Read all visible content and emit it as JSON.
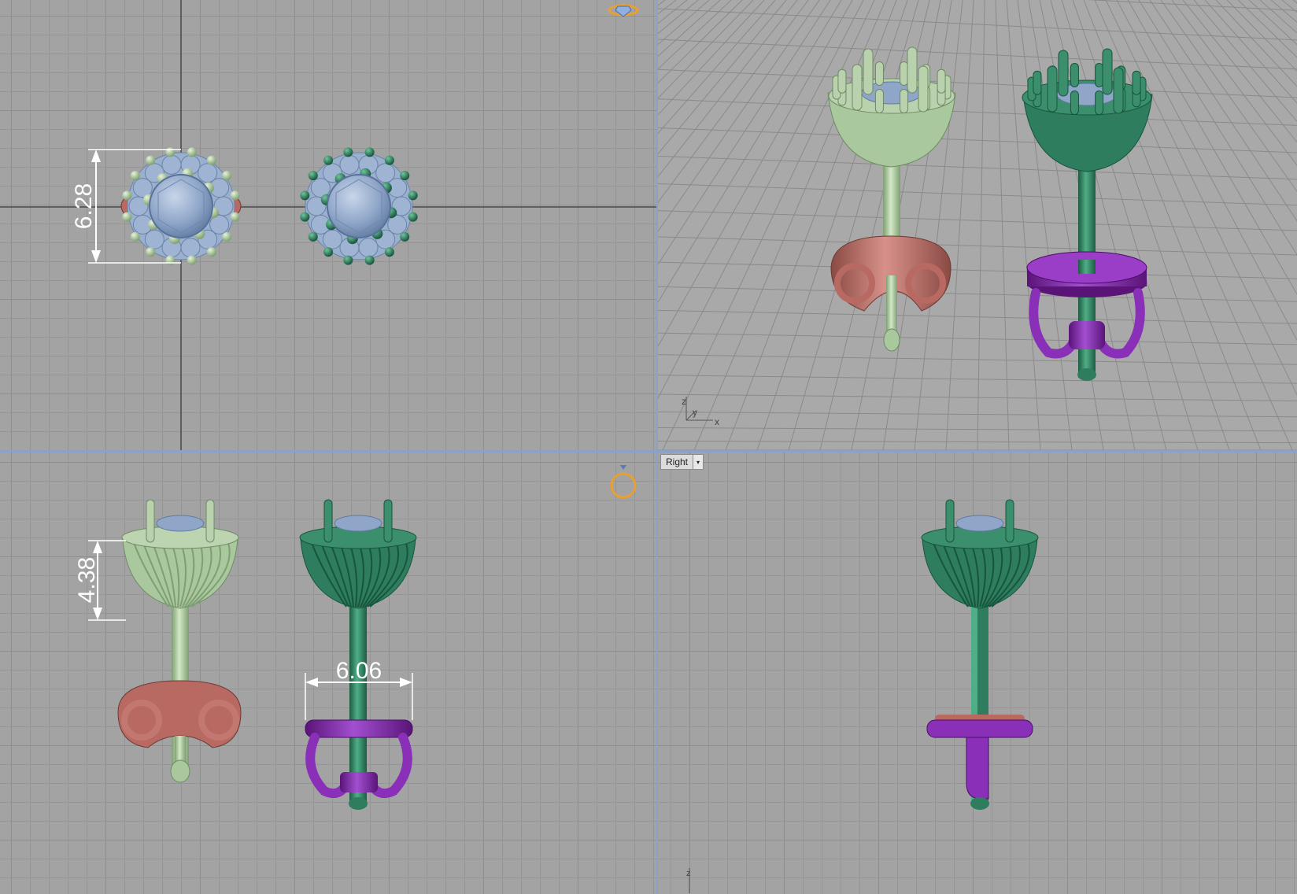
{
  "viewports": {
    "top": {
      "dimension_label": "6.28"
    },
    "perspective": {
      "axis": {
        "z": "z",
        "y": "y",
        "x": "x"
      }
    },
    "front": {
      "dimension_height": "4.38",
      "dimension_width": "6.06"
    },
    "right": {
      "label": "Right",
      "dropdown_glyph": "▾",
      "axis": {
        "z": "z"
      }
    }
  },
  "icons": [
    "gem-ring-icon",
    "ring-outline-icon",
    "viewport-dropdown-icon",
    "axis-gizmo-icon"
  ],
  "colors": {
    "light_green_metal": "#a9c89d",
    "dark_green_metal": "#2e7d5e",
    "rose_metal": "#b86a62",
    "purple_metal": "#7a2a9c",
    "gem_blue": "#8fa6c8",
    "grid_line": "#8e8e8e",
    "viewport_border": "#8aa2c8",
    "dimension": "#ffffff"
  }
}
